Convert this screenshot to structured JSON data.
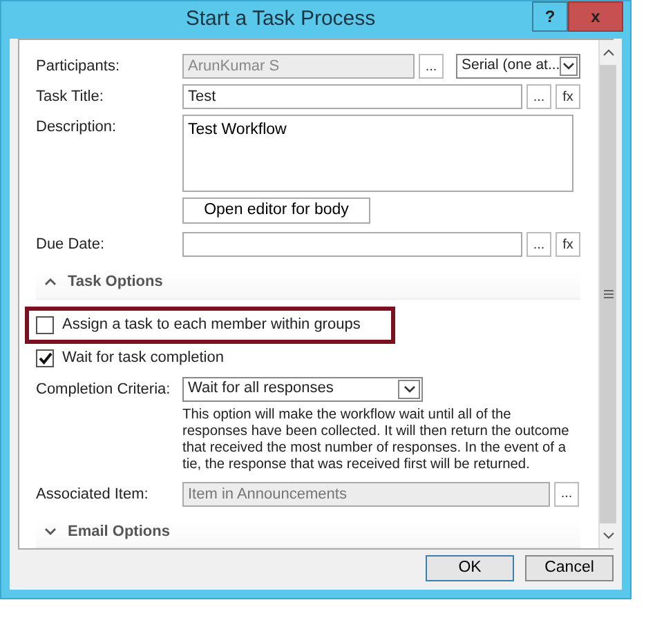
{
  "window": {
    "title": "Start a Task Process",
    "help": "?",
    "close": "x"
  },
  "fields": [
    {
      "kind": "picker",
      "label": "Participants:",
      "value": "ArunKumar S",
      "disabled": true,
      "dots": "...",
      "select": "Serial (one at..."
    },
    {
      "kind": "text",
      "label": "Task Title:",
      "value": "Test",
      "disabled": false,
      "dots": "...",
      "fx": "fx"
    },
    {
      "kind": "area",
      "label": "Description:",
      "value": "Test Workflow",
      "button": "Open editor for body"
    },
    {
      "kind": "text",
      "label": "Due Date:",
      "disabled": false,
      "dots": "...",
      "fx": "fx"
    }
  ],
  "task_options": {
    "title": "Task Options",
    "expanded": true,
    "checks": [
      {
        "label": "Assign a task to each member within groups",
        "checked": false,
        "highlighted": true
      },
      {
        "label": "Wait for task completion",
        "checked": true,
        "highlighted": false
      }
    ],
    "completion_criteria": {
      "label": "Completion Criteria:",
      "value": "Wait for all responses",
      "help": "This option will make the workflow wait until all of the responses have been collected. It will then return the outcome that received the most number of responses. In the event of a tie, the response that was received first will be returned."
    },
    "associated_item": {
      "label": "Associated Item:",
      "placeholder": "Item in Announcements",
      "dots": "..."
    }
  },
  "email_options": {
    "title": "Email Options",
    "expanded": false
  },
  "buttons": [
    "OK",
    "Cancel"
  ]
}
